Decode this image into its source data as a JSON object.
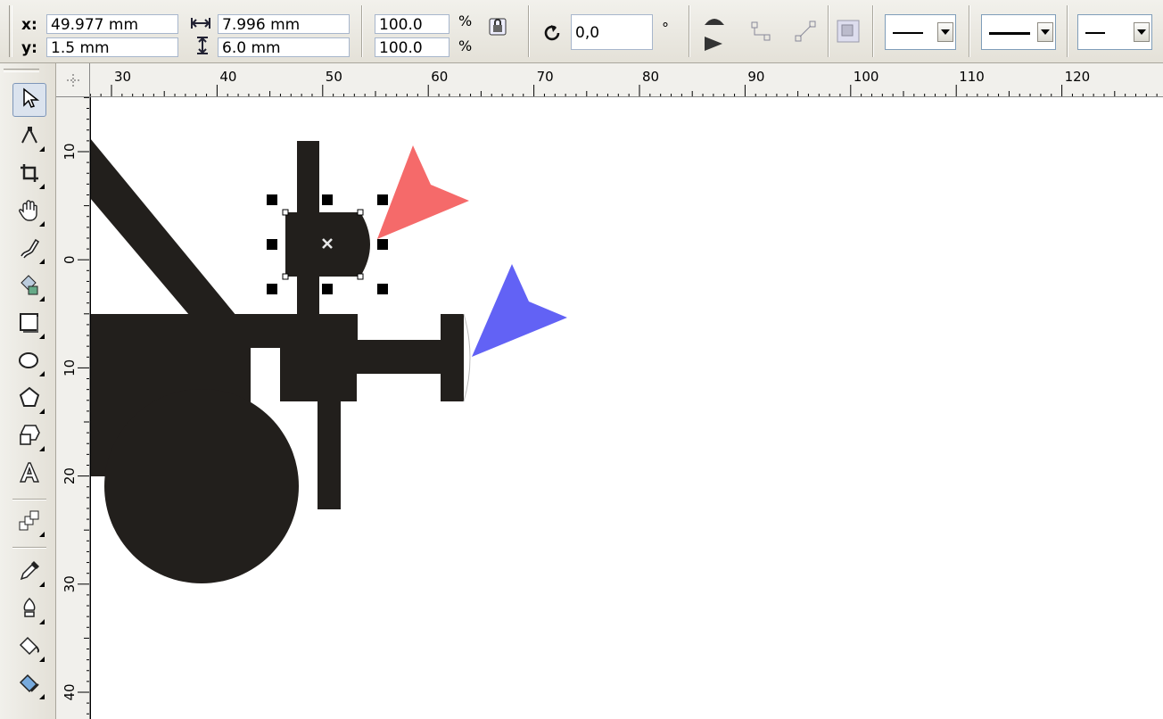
{
  "propbar": {
    "x_label": "x:",
    "y_label": "y:",
    "x_value": "49.977 mm",
    "y_value": "1.5 mm",
    "width_value": "7.996 mm",
    "height_value": "6.0 mm",
    "scale_x": "100.0",
    "scale_y": "100.0",
    "percent_symbol": "%",
    "rotation_value": "0,0",
    "degree_symbol": "°",
    "line_dropdowns": [
      "start-arrowhead",
      "line-style",
      "end-arrowhead"
    ]
  },
  "ruler": {
    "h_labels": [
      "30",
      "40",
      "50",
      "60",
      "70",
      "80",
      "90",
      "100",
      "110",
      "120"
    ],
    "v_labels": [
      "10",
      "0",
      "10",
      "20",
      "30",
      "40"
    ]
  },
  "toolbox": {
    "tools": [
      "pick-tool",
      "shape-tool",
      "crop-tool",
      "pan-tool",
      "freehand-tool",
      "smart-fill-tool",
      "rectangle-tool",
      "ellipse-tool",
      "polygon-tool",
      "basic-shapes-tool",
      "text-tool",
      "blend-tool",
      "eyedropper-tool",
      "outline-tool",
      "fill-tool",
      "interactive-fill-tool"
    ]
  },
  "colors": {
    "shape_fill": "#221f1c",
    "red_arrow": "#f56a6a",
    "blue_arrow": "#6262f5",
    "canvas": "#ffffff"
  }
}
